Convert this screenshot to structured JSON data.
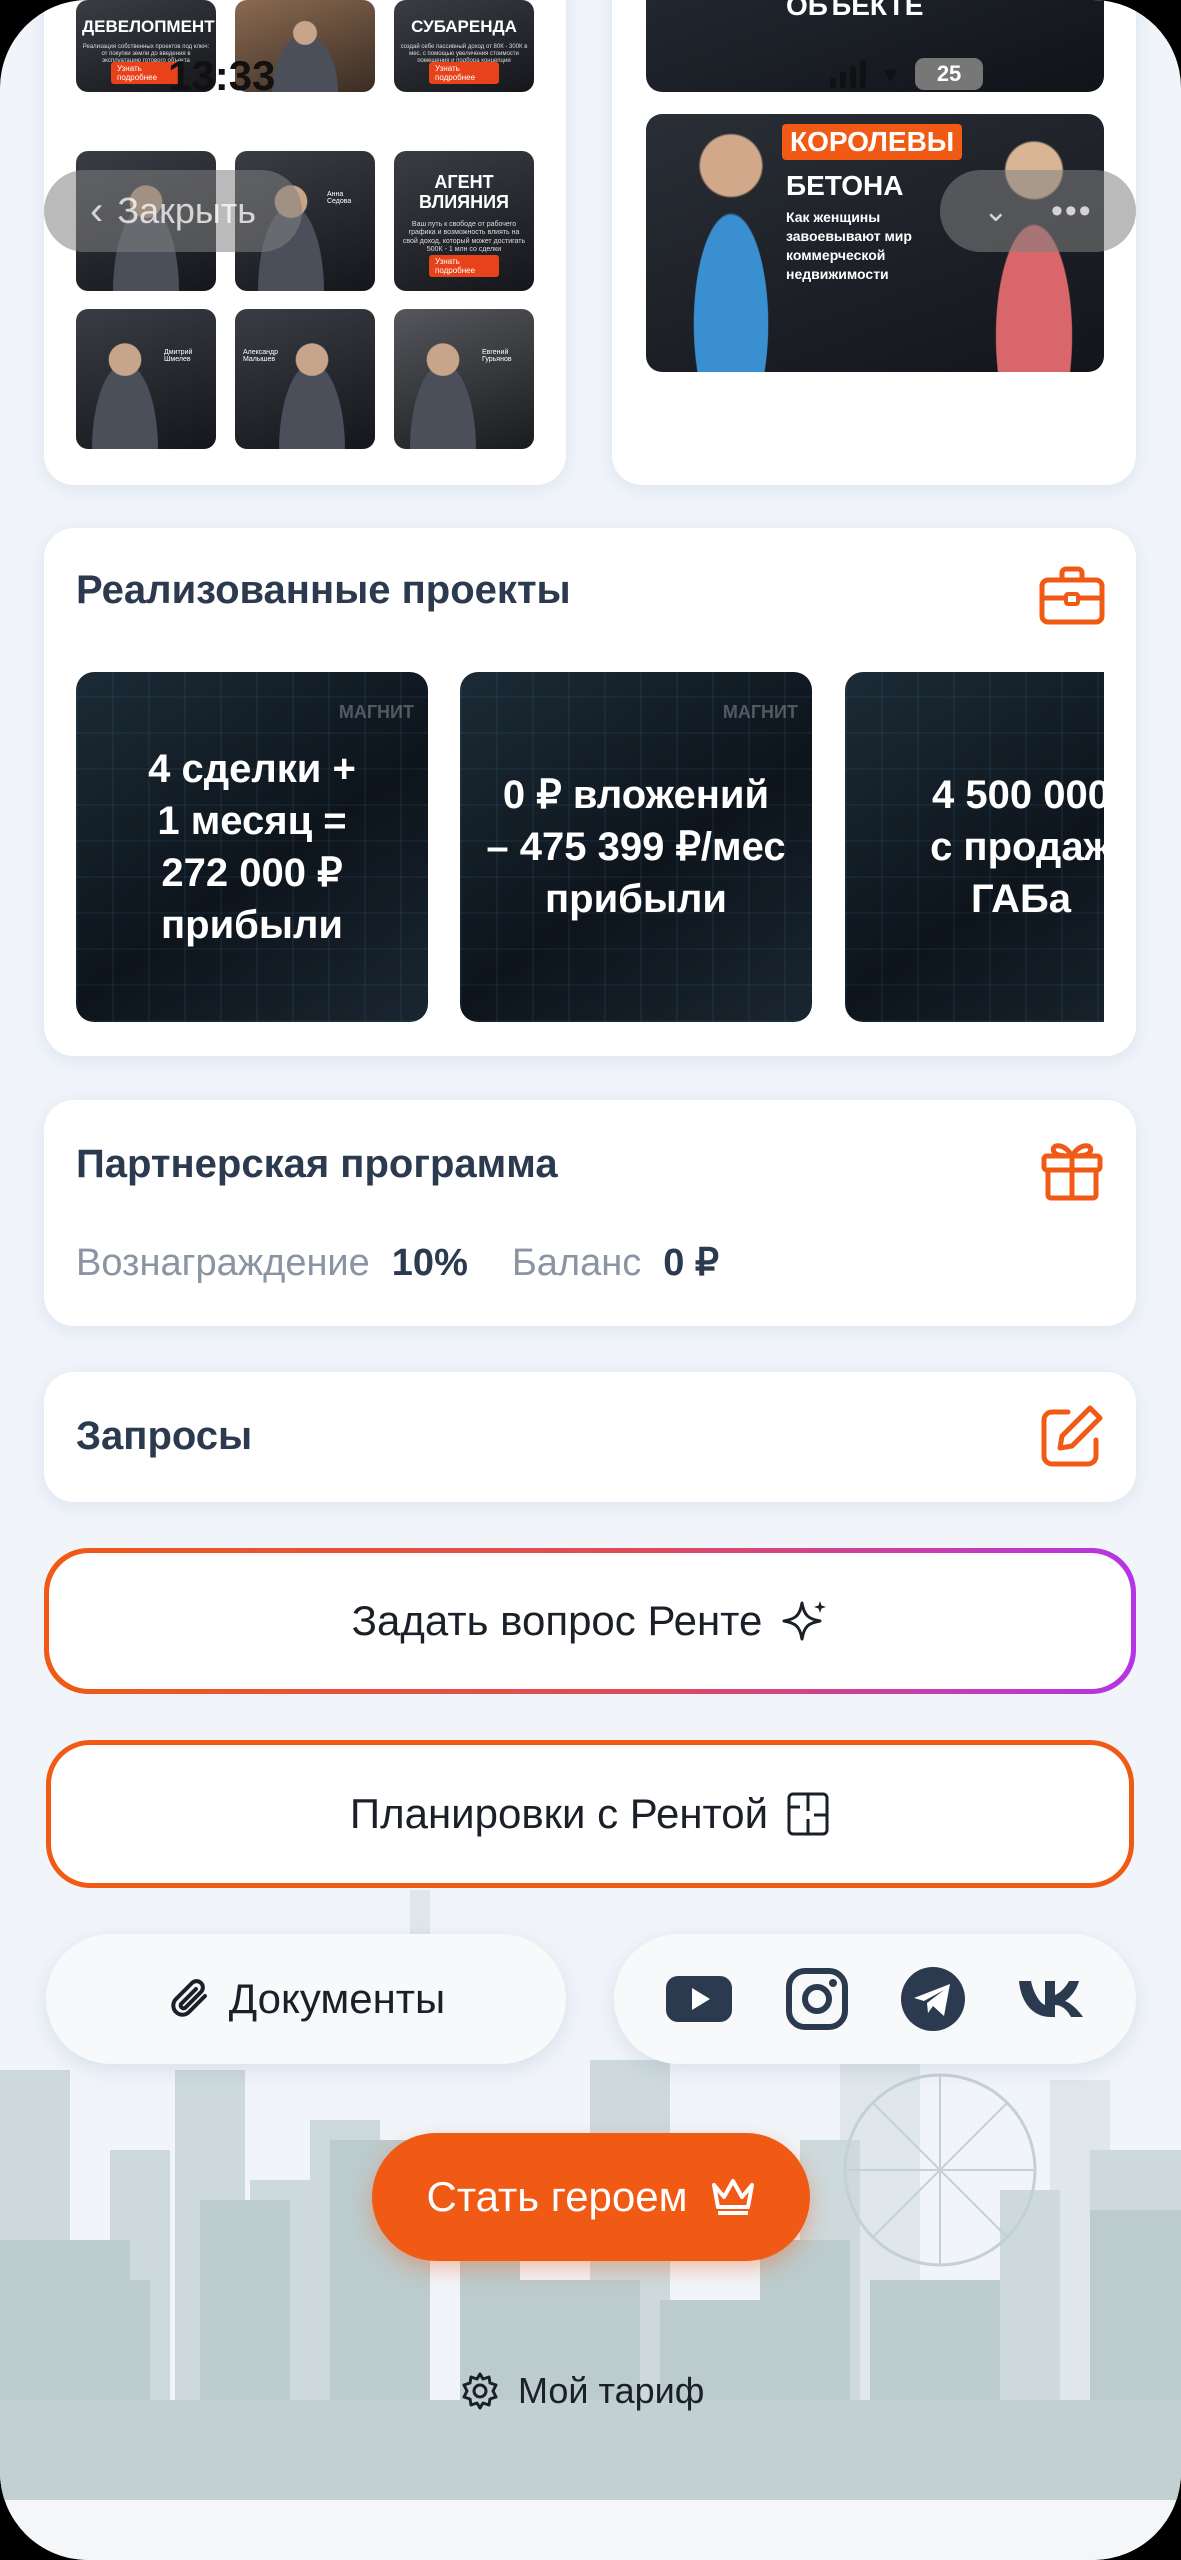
{
  "status_bar": {
    "time": "13:33",
    "battery": "25"
  },
  "nav": {
    "close_label": "Закрыть"
  },
  "thumbnails": [
    {
      "title": "ДЕВЕЛОПМЕНТ",
      "caption": "Реализация собственных проектов под ключ: от покупки земли до введения в эксплуатацию готового объекта",
      "badge": "Узнать подробнее"
    },
    {
      "title": "",
      "caption": "",
      "badge": ""
    },
    {
      "title": "СУБАРЕНДА",
      "caption": "создай себе пассивный доход от 80К - 300К в мес. с помощью увеличения стоимости помещения и подбора концепции",
      "badge": "Узнать подробнее"
    },
    {
      "title": "",
      "caption": "Анна Седова",
      "badge": ""
    },
    {
      "title": "АГЕНТ ВЛИЯНИЯ",
      "caption": "Ваш путь к свободе от рабочего графика и возможность влиять на свой доход, который может достигать 500К - 1 млн со сделки",
      "badge": "Узнать подробнее"
    },
    {
      "title": "",
      "caption": "Дмитрий Шмелев",
      "badge": ""
    },
    {
      "title": "",
      "caption": "Александр Малышев",
      "badge": ""
    },
    {
      "title": "",
      "caption": "Евгений Гурьянов",
      "badge": ""
    }
  ],
  "podcast": {
    "top_title": "ОБЪЕКТЕ",
    "badge_line": "КОРОЛЕВЫ",
    "title_line": "БЕТОНА",
    "subtitle": "Как женщины завоевывают мир коммерческой недвижимости"
  },
  "projects": {
    "title": "Реализованные проекты",
    "items": [
      {
        "text": "4 сделки +\n1 месяц =\n272 000 ₽\nприбыли",
        "brand": "МАГНИТ"
      },
      {
        "text": "0 ₽ вложений\n– 475 399 ₽/мес\nприбыли",
        "brand": "МАГНИТ"
      },
      {
        "text": "4 500 000\nс продаж\nГАБа",
        "brand": ""
      }
    ]
  },
  "partner": {
    "title": "Партнерская программа",
    "reward_label": "Вознаграждение",
    "reward_value": "10%",
    "balance_label": "Баланс",
    "balance_value": "0 ₽"
  },
  "requests": {
    "title": "Запросы"
  },
  "ask_button": {
    "label": "Задать вопрос Ренте"
  },
  "layouts_button": {
    "label": "Планировки с Рентой"
  },
  "documents": {
    "label": "Документы"
  },
  "socials": [
    "youtube-icon",
    "instagram-icon",
    "telegram-icon",
    "vk-icon"
  ],
  "hero_button": {
    "label": "Стать героем"
  },
  "tariff": {
    "label": "Мой тариф"
  },
  "colors": {
    "accent": "#f05a14",
    "text_dark": "#2b3a4e",
    "gradient_end": "#b534e8"
  }
}
